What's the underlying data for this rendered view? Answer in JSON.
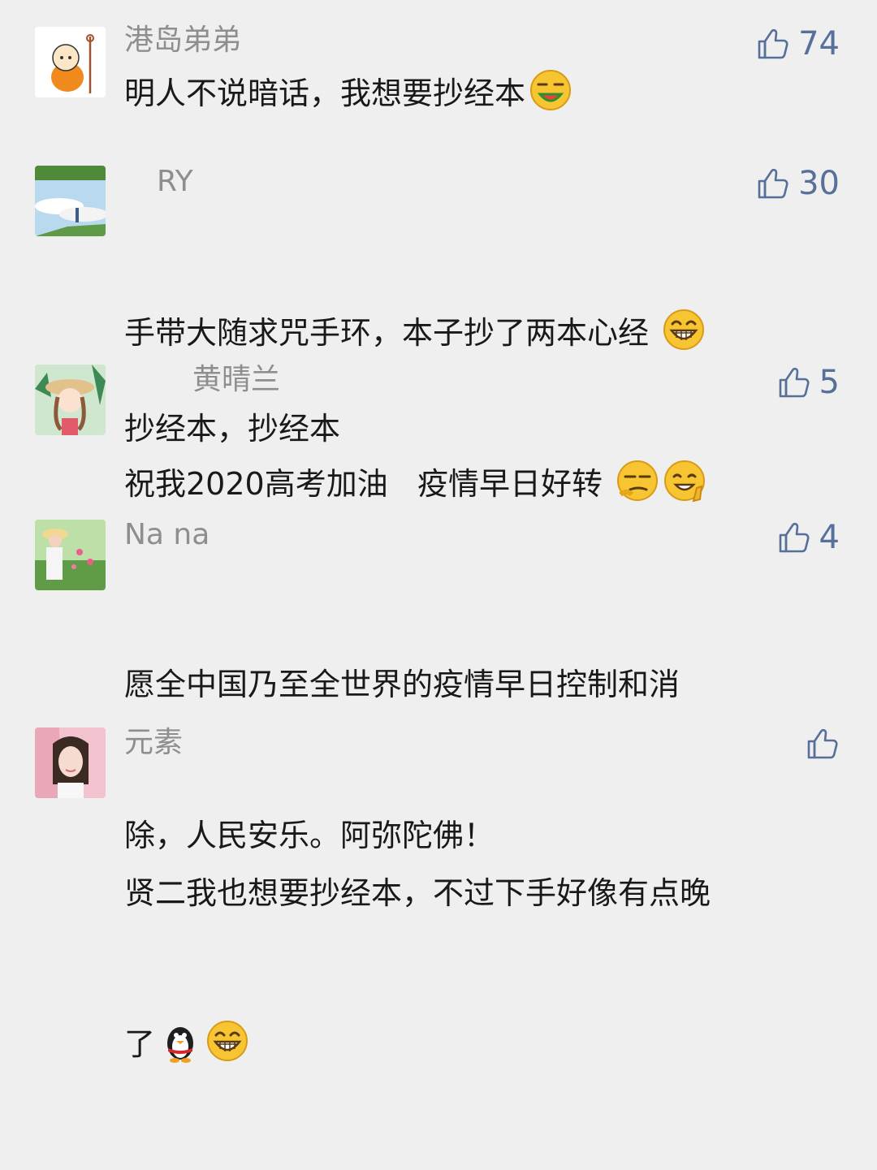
{
  "comments": [
    {
      "name": "港岛弟弟",
      "likes": "74",
      "lines": [
        "明人不说暗话，我想要抄经本"
      ]
    },
    {
      "name": "RY",
      "likes": "30",
      "lines": [
        "手带大随求咒手环，本子抄了两本心经",
        "祝我2020高考加油   疫情早日好转"
      ]
    },
    {
      "name": "黄晴兰",
      "likes": "5",
      "lines": [
        "抄经本，抄经本"
      ]
    },
    {
      "name": "Na na",
      "likes": "4",
      "lines": [
        "愿全中国乃至全世界的疫情早日控制和消",
        "除，人民安乐。阿弥陀佛！"
      ]
    },
    {
      "name": "元素",
      "likes": "",
      "lines": [
        "贤二我也想要抄经本，不过下手好像有点晚",
        "了"
      ]
    }
  ],
  "colors": {
    "background": "#efefef",
    "name": "#8e8e8e",
    "text": "#191919",
    "like": "#56709a"
  },
  "icons": {
    "like": "thumbs-up-icon"
  }
}
